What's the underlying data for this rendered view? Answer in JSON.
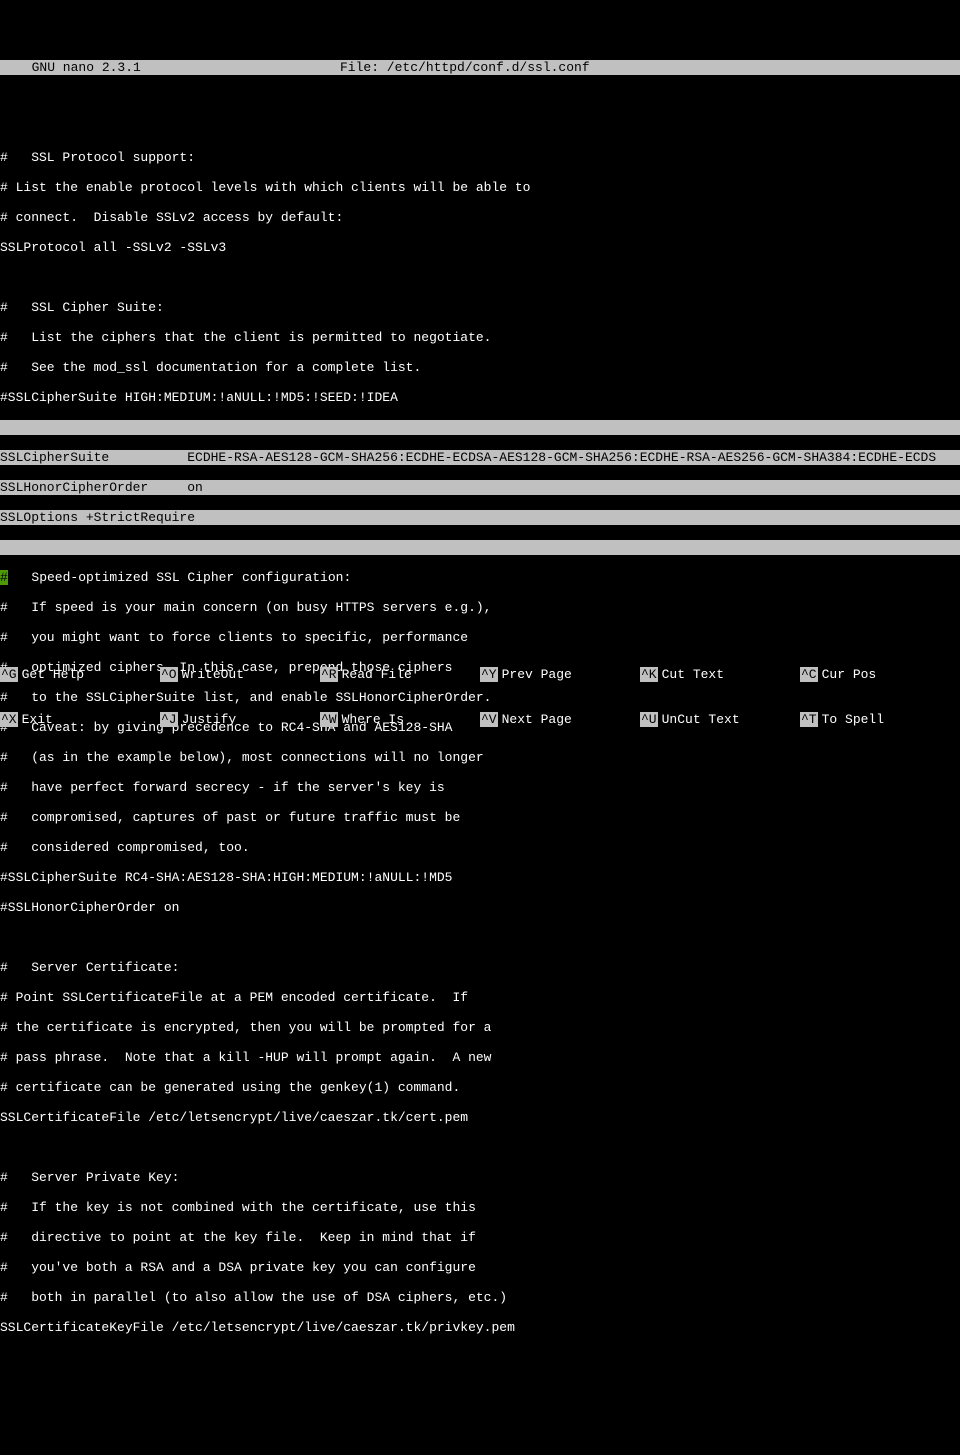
{
  "title": {
    "app": "  GNU nano 2.3.1",
    "file": "File: /etc/httpd/conf.d/ssl.conf"
  },
  "lines": {
    "l1": "#   SSL Protocol support:",
    "l2": "# List the enable protocol levels with which clients will be able to",
    "l3": "# connect.  Disable SSLv2 access by default:",
    "l4": "SSLProtocol all -SSLv2 -SSLv3",
    "l5": "#   SSL Cipher Suite:",
    "l6": "#   List the ciphers that the client is permitted to negotiate.",
    "l7": "#   See the mod_ssl documentation for a complete list.",
    "l8": "#SSLCipherSuite HIGH:MEDIUM:!aNULL:!MD5:!SEED:!IDEA",
    "h1": "SSLCipherSuite          ECDHE-RSA-AES128-GCM-SHA256:ECDHE-ECDSA-AES128-GCM-SHA256:ECDHE-RSA-AES256-GCM-SHA384:ECDHE-ECDS",
    "h2": "SSLHonorCipherOrder     on",
    "h3": "SSLOptions +StrictRequire",
    "c_after": "   Speed-optimized SSL Cipher configuration:",
    "l9": "#   If speed is your main concern (on busy HTTPS servers e.g.),",
    "l10": "#   you might want to force clients to specific, performance",
    "l11": "#   optimized ciphers. In this case, prepend those ciphers",
    "l12": "#   to the SSLCipherSuite list, and enable SSLHonorCipherOrder.",
    "l13": "#   Caveat: by giving precedence to RC4-SHA and AES128-SHA",
    "l14": "#   (as in the example below), most connections will no longer",
    "l15": "#   have perfect forward secrecy - if the server's key is",
    "l16": "#   compromised, captures of past or future traffic must be",
    "l17": "#   considered compromised, too.",
    "l18": "#SSLCipherSuite RC4-SHA:AES128-SHA:HIGH:MEDIUM:!aNULL:!MD5",
    "l19": "#SSLHonorCipherOrder on",
    "l20": "#   Server Certificate:",
    "l21": "# Point SSLCertificateFile at a PEM encoded certificate.  If",
    "l22": "# the certificate is encrypted, then you will be prompted for a",
    "l23": "# pass phrase.  Note that a kill -HUP will prompt again.  A new",
    "l24": "# certificate can be generated using the genkey(1) command.",
    "l25": "SSLCertificateFile /etc/letsencrypt/live/caeszar.tk/cert.pem",
    "l26": "#   Server Private Key:",
    "l27": "#   If the key is not combined with the certificate, use this",
    "l28": "#   directive to point at the key file.  Keep in mind that if",
    "l29": "#   you've both a RSA and a DSA private key you can configure",
    "l30": "#   both in parallel (to also allow the use of DSA ciphers, etc.)",
    "l31": "SSLCertificateKeyFile /etc/letsencrypt/live/caeszar.tk/privkey.pem"
  },
  "shortcuts": {
    "r1": [
      {
        "key": "^G",
        "label": "Get Help"
      },
      {
        "key": "^O",
        "label": "WriteOut"
      },
      {
        "key": "^R",
        "label": "Read File"
      },
      {
        "key": "^Y",
        "label": "Prev Page"
      },
      {
        "key": "^K",
        "label": "Cut Text"
      },
      {
        "key": "^C",
        "label": "Cur Pos"
      }
    ],
    "r2": [
      {
        "key": "^X",
        "label": "Exit"
      },
      {
        "key": "^J",
        "label": "Justify"
      },
      {
        "key": "^W",
        "label": "Where Is"
      },
      {
        "key": "^V",
        "label": "Next Page"
      },
      {
        "key": "^U",
        "label": "UnCut Text"
      },
      {
        "key": "^T",
        "label": "To Spell"
      }
    ]
  }
}
